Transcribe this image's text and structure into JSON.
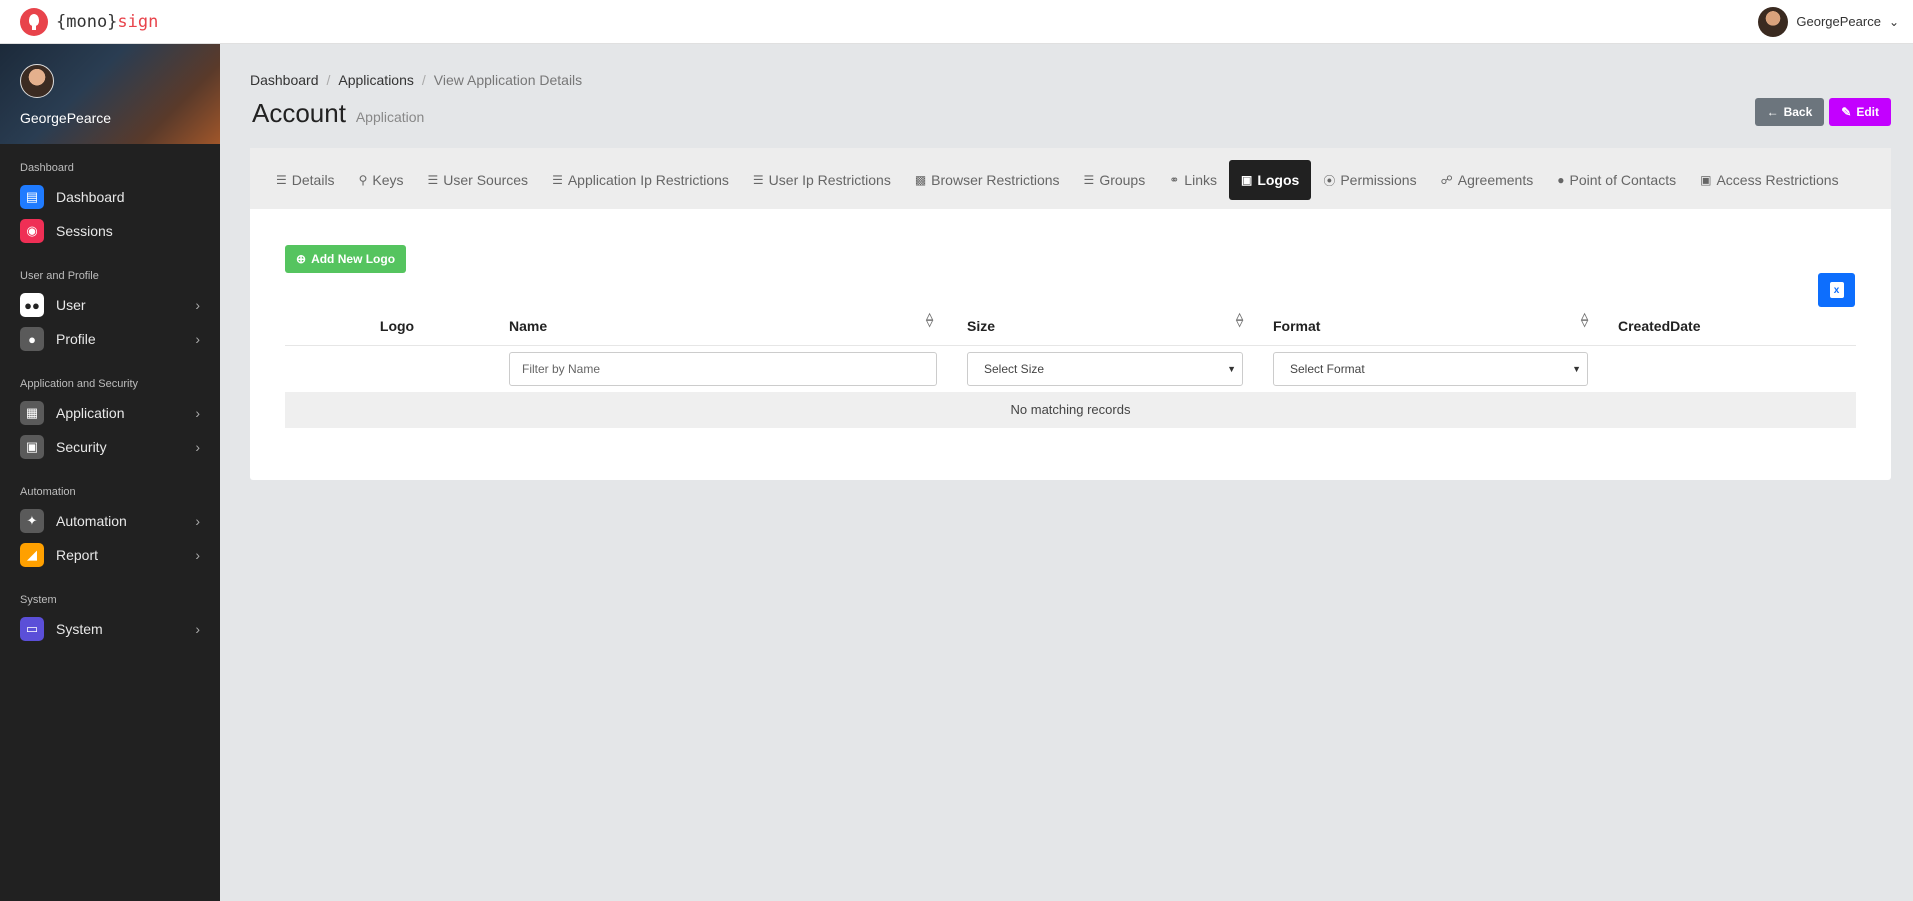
{
  "app": {
    "brand_prefix": "{mono}",
    "brand_suffix": "sign"
  },
  "topbar": {
    "username": "GeorgePearce"
  },
  "sidebar": {
    "profile_name": "GeorgePearce",
    "sections": [
      {
        "title": "Dashboard",
        "items": [
          {
            "label": "Dashboard",
            "icon": "chart-icon",
            "color": "#1f7bff",
            "has_arrow": false
          },
          {
            "label": "Sessions",
            "icon": "record-icon",
            "color": "#ef2f55",
            "has_arrow": false
          }
        ]
      },
      {
        "title": "User and Profile",
        "items": [
          {
            "label": "User",
            "icon": "users-icon",
            "color": "#ffffff",
            "has_arrow": true
          },
          {
            "label": "Profile",
            "icon": "person-icon",
            "color": "#5a5a5a",
            "has_arrow": true
          }
        ]
      },
      {
        "title": "Application and Security",
        "items": [
          {
            "label": "Application",
            "icon": "window-icon",
            "color": "#5a5a5a",
            "has_arrow": true
          },
          {
            "label": "Security",
            "icon": "lock-icon",
            "color": "#5a5a5a",
            "has_arrow": true
          }
        ]
      },
      {
        "title": "Automation",
        "items": [
          {
            "label": "Automation",
            "icon": "wand-icon",
            "color": "#5a5a5a",
            "has_arrow": true
          },
          {
            "label": "Report",
            "icon": "area-chart-icon",
            "color": "#ffa000",
            "has_arrow": true
          }
        ]
      },
      {
        "title": "System",
        "items": [
          {
            "label": "System",
            "icon": "monitor-icon",
            "color": "#5b4fd8",
            "has_arrow": true
          }
        ]
      }
    ]
  },
  "breadcrumb": {
    "items": [
      "Dashboard",
      "Applications",
      "View Application Details"
    ]
  },
  "header": {
    "title": "Account",
    "subtitle": "Application",
    "back_label": "Back",
    "edit_label": "Edit"
  },
  "tabs": [
    {
      "label": "Details",
      "icon": "list-icon",
      "active": false
    },
    {
      "label": "Keys",
      "icon": "key-icon",
      "active": false
    },
    {
      "label": "User Sources",
      "icon": "list-icon",
      "active": false
    },
    {
      "label": "Application Ip Restrictions",
      "icon": "list-icon",
      "active": false
    },
    {
      "label": "User Ip Restrictions",
      "icon": "list-icon",
      "active": false
    },
    {
      "label": "Browser Restrictions",
      "icon": "browser-icon",
      "active": false
    },
    {
      "label": "Groups",
      "icon": "list-icon",
      "active": false
    },
    {
      "label": "Links",
      "icon": "link-icon",
      "active": false
    },
    {
      "label": "Logos",
      "icon": "images-icon",
      "active": true
    },
    {
      "label": "Permissions",
      "icon": "toggle-icon",
      "active": false
    },
    {
      "label": "Agreements",
      "icon": "handshake-icon",
      "active": false
    },
    {
      "label": "Point of Contacts",
      "icon": "users-icon",
      "active": false
    },
    {
      "label": "Access Restrictions",
      "icon": "unlock-icon",
      "active": false
    }
  ],
  "logos": {
    "add_label": "Add New Logo",
    "columns": [
      "Logo",
      "Name",
      "Size",
      "Format",
      "CreatedDate"
    ],
    "filters": {
      "name_placeholder": "Filter by Name",
      "size_selected": "Select Size",
      "format_selected": "Select Format"
    },
    "empty_message": "No matching records"
  }
}
